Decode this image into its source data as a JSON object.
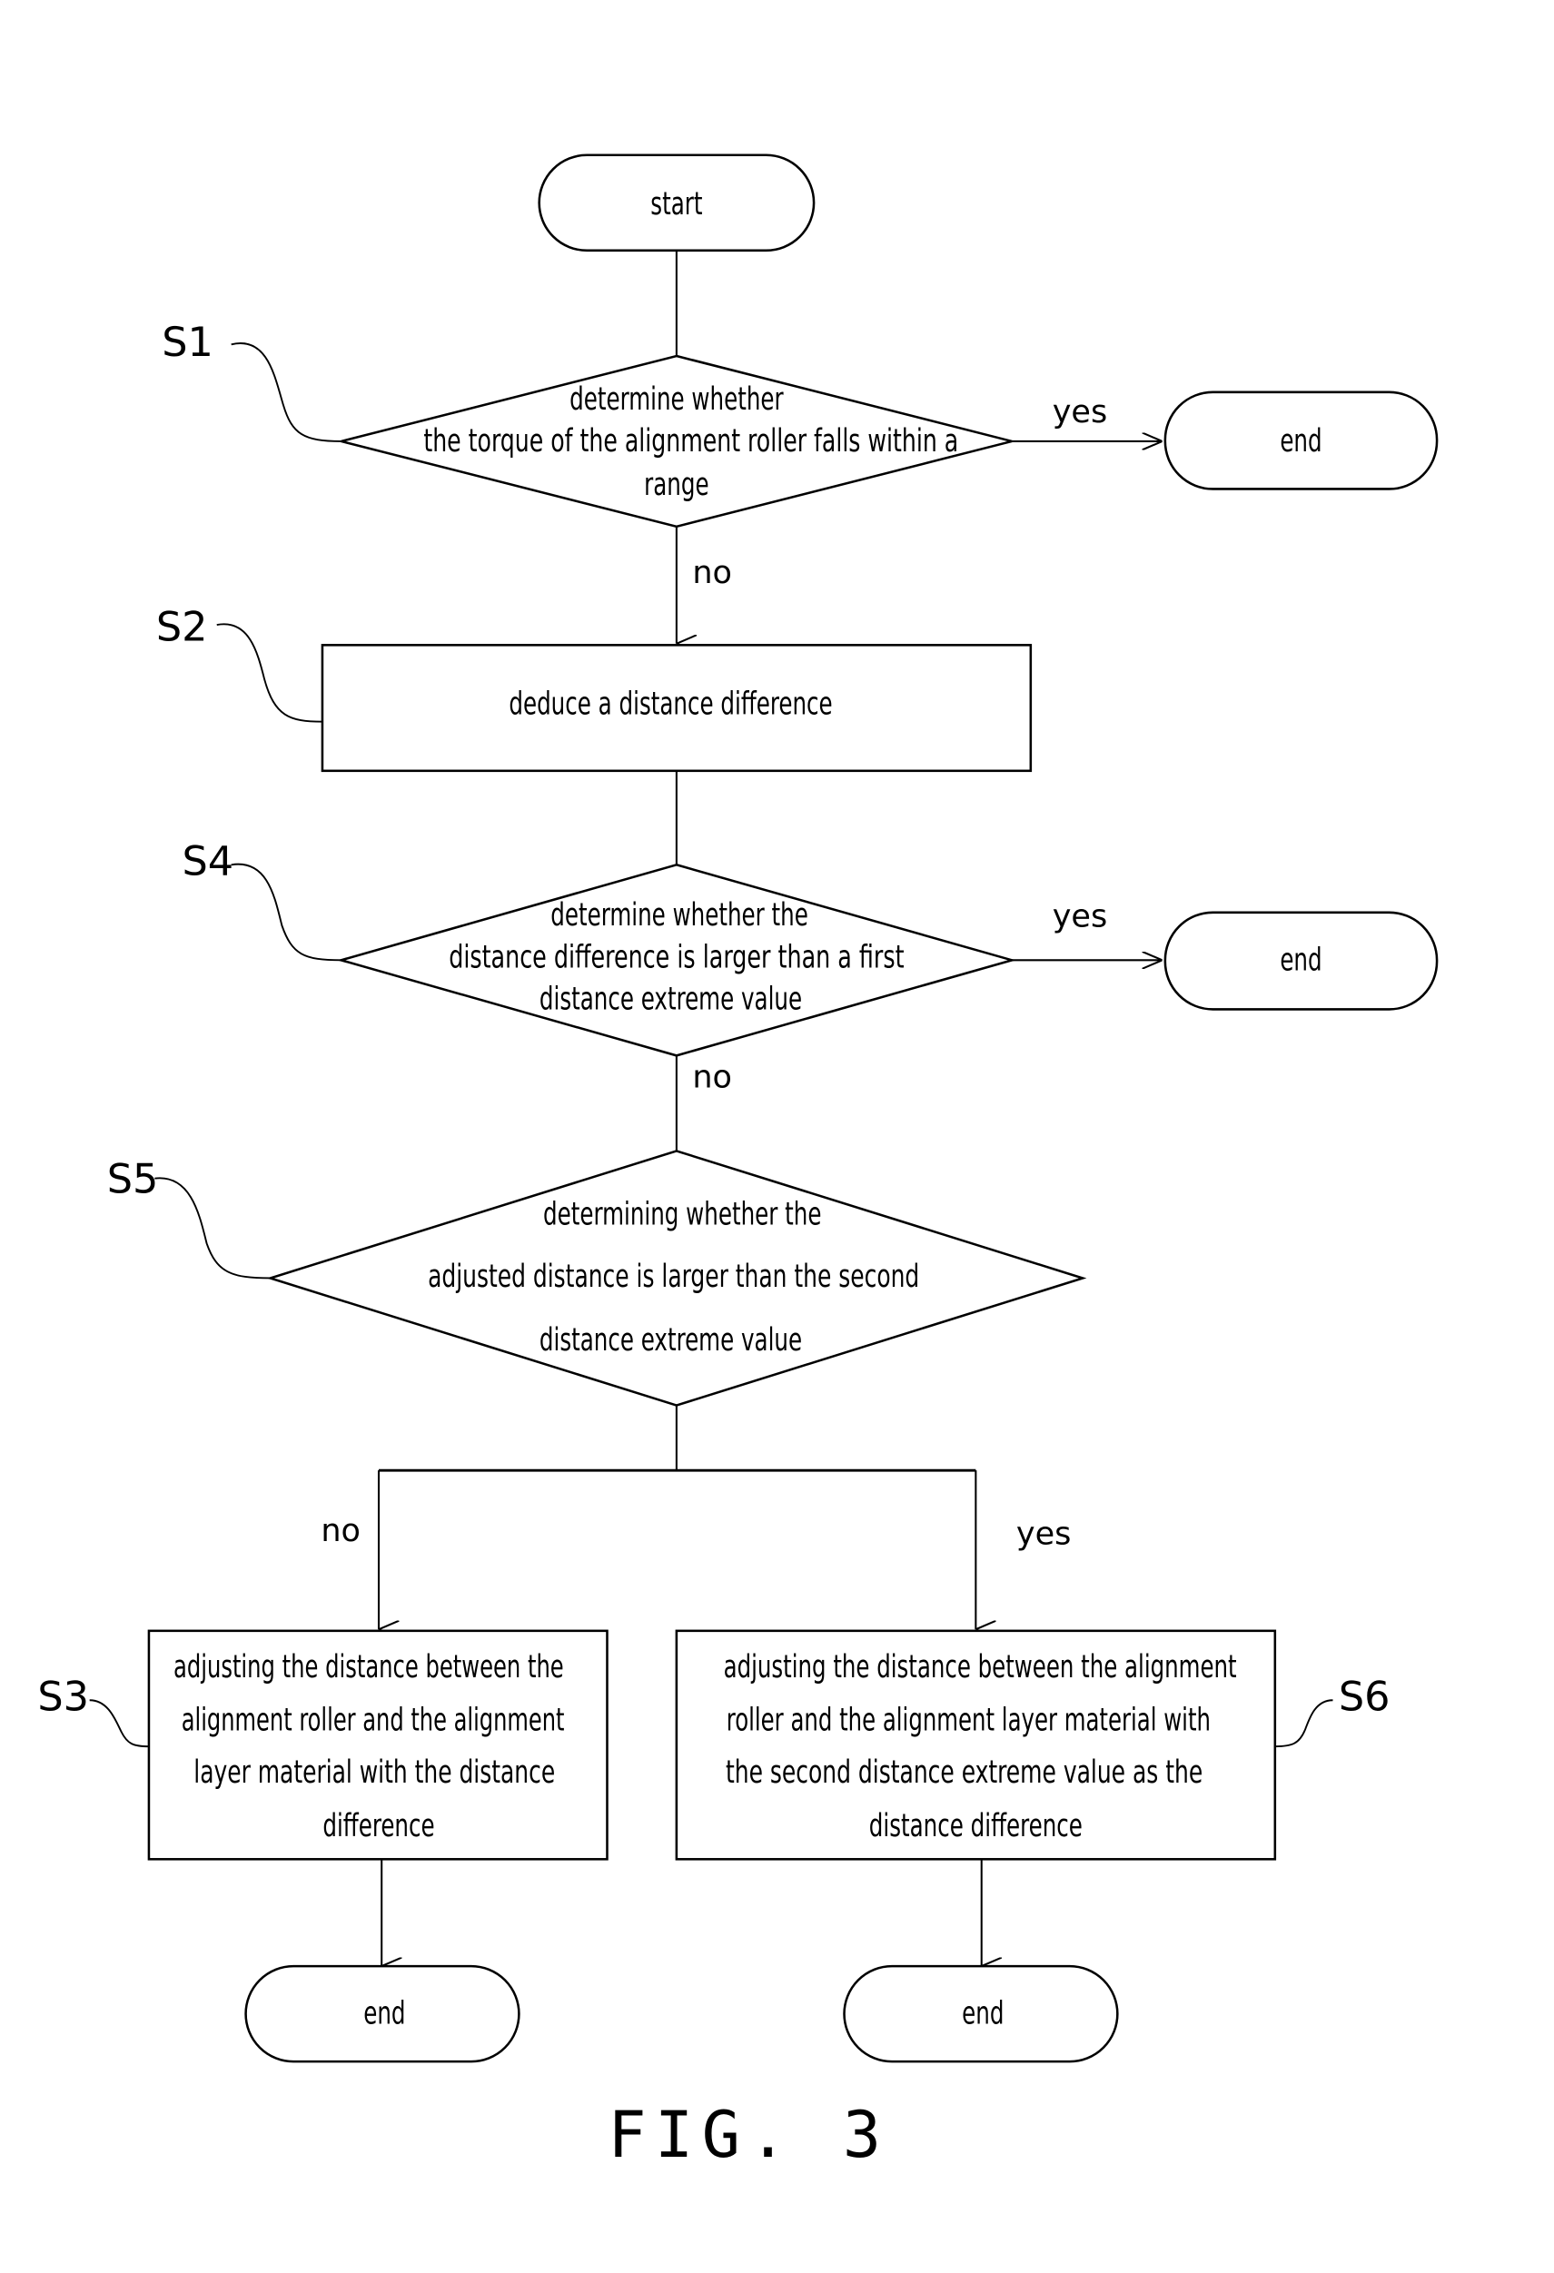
{
  "figure": {
    "caption": "FIG. 3",
    "nodes": {
      "start": {
        "type": "terminator",
        "text": "start"
      },
      "s1": {
        "type": "decision",
        "label": "S1",
        "lines": [
          "determine whether",
          "the torque of the alignment roller falls within a",
          "range"
        ]
      },
      "end1": {
        "type": "terminator",
        "text": "end"
      },
      "s2": {
        "type": "process",
        "label": "S2",
        "lines": [
          "deduce a distance difference"
        ]
      },
      "s4": {
        "type": "decision",
        "label": "S4",
        "lines": [
          "determine whether the",
          "distance difference is larger than a first",
          "distance extreme value"
        ]
      },
      "end2": {
        "type": "terminator",
        "text": "end"
      },
      "s5": {
        "type": "decision",
        "label": "S5",
        "lines": [
          "determining whether the",
          "adjusted distance is larger than the second",
          "distance extreme value"
        ]
      },
      "s3": {
        "type": "process",
        "label": "S3",
        "lines": [
          "adjusting the distance between the",
          "alignment roller and the alignment",
          "layer material with the distance",
          "difference"
        ]
      },
      "s6": {
        "type": "process",
        "label": "S6",
        "lines": [
          "adjusting the distance between the alignment",
          "roller and the alignment layer material with",
          "the second distance extreme value as the",
          "distance difference"
        ]
      },
      "end3": {
        "type": "terminator",
        "text": "end"
      },
      "end4": {
        "type": "terminator",
        "text": "end"
      }
    },
    "edges": {
      "s1_yes": "yes",
      "s1_no": "no",
      "s4_yes": "yes",
      "s4_no": "no",
      "s5_no": "no",
      "s5_yes": "yes"
    }
  }
}
